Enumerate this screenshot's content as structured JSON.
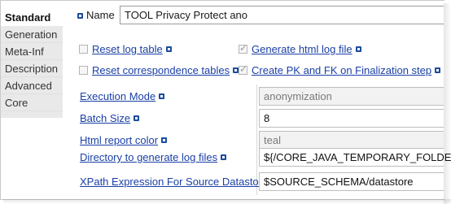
{
  "tabs": [
    "Standard",
    "Generation",
    "Meta-Inf",
    "Description",
    "Advanced",
    "Core"
  ],
  "name": {
    "label": "Name",
    "value": "TOOL Privacy Protect ano"
  },
  "checks": [
    {
      "label": "Reset log table",
      "checked": false
    },
    {
      "label": "Generate html log file",
      "checked": true
    },
    {
      "label": "Reset correspondence tables",
      "checked": false
    },
    {
      "label": "Create PK and FK on Finalization step",
      "checked": true
    }
  ],
  "params": [
    {
      "label": "Execution Mode",
      "value": "anonymization",
      "editable": false
    },
    {
      "label": "Batch Size",
      "value": "8",
      "editable": true
    },
    {
      "label": "Html report color",
      "value": "teal",
      "editable": false
    },
    {
      "label": "Directory to generate log files",
      "value": "${/CORE_JAVA_TEMPORARY_FOLDER}$",
      "editable": true
    },
    {
      "label": "XPath Expression For Source Datastores",
      "value": "$SOURCE_SCHEMA/datastore",
      "editable": true
    }
  ],
  "colors": {
    "link": "#1a3fa6",
    "info_icon": "#1c4c9c",
    "tab_bg": "#e9e9e9"
  }
}
